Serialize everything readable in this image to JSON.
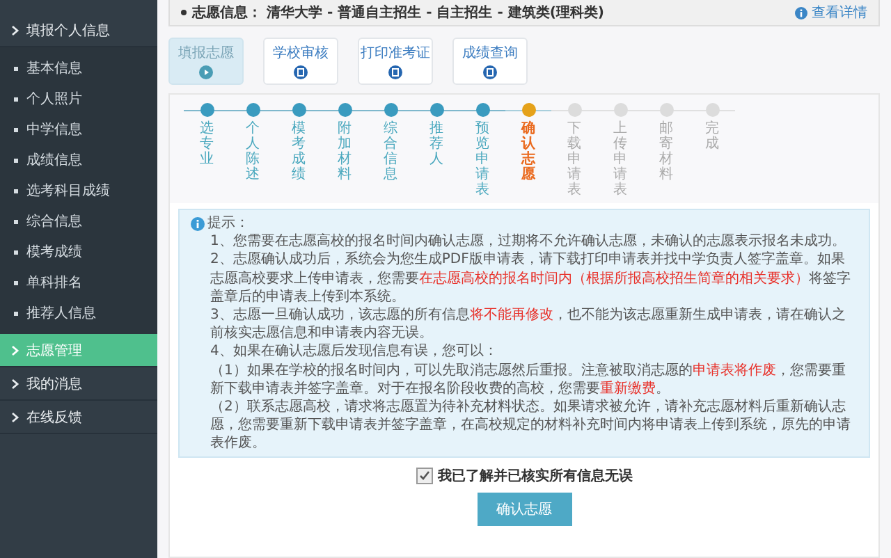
{
  "sidebar": {
    "items": [
      {
        "label": "填报个人信息",
        "selected": false,
        "children": [
          {
            "label": "基本信息"
          },
          {
            "label": "个人照片"
          },
          {
            "label": "中学信息"
          },
          {
            "label": "成绩信息"
          },
          {
            "label": "选考科目成绩"
          },
          {
            "label": "综合信息"
          },
          {
            "label": "模考成绩"
          },
          {
            "label": "单科排名"
          },
          {
            "label": "推荐人信息"
          }
        ]
      },
      {
        "label": "志愿管理",
        "selected": true
      },
      {
        "label": "我的消息",
        "selected": false
      },
      {
        "label": "在线反馈",
        "selected": false
      }
    ]
  },
  "info_bar": {
    "text": "志愿信息： 清华大学 - 普通自主招生 - 自主招生 - 建筑类(理科类)",
    "link": "查看详情"
  },
  "tabs": [
    {
      "label": "填报志愿",
      "selected": true
    },
    {
      "label": "学校审核",
      "selected": false
    },
    {
      "label": "打印准考证",
      "selected": false
    },
    {
      "label": "成绩查询",
      "selected": false
    }
  ],
  "steps": [
    {
      "label": "选专业",
      "done": true,
      "selected": false
    },
    {
      "label": "个人陈述",
      "done": true,
      "selected": false
    },
    {
      "label": "模考成绩",
      "done": true,
      "selected": false
    },
    {
      "label": "附加材料",
      "done": true,
      "selected": false
    },
    {
      "label": "综合信息",
      "done": true,
      "selected": false
    },
    {
      "label": "推荐人",
      "done": true,
      "selected": false
    },
    {
      "label": "预览申请表",
      "done": true,
      "selected": false
    },
    {
      "label": "确认志愿",
      "done": false,
      "selected": true
    },
    {
      "label": "下载申请表",
      "done": false,
      "selected": false
    },
    {
      "label": "上传申请表",
      "done": false,
      "selected": false
    },
    {
      "label": "邮寄材料",
      "done": false,
      "selected": false
    },
    {
      "label": "完成",
      "done": false,
      "selected": false
    }
  ],
  "notice": {
    "title": "提示：",
    "paragraphs": [
      {
        "parts": [
          {
            "text": "1、您需要在志愿高校的报名时间内确认志愿，过期将不允许确认志愿，未确认的志愿表示报名未成功。",
            "highlight": false
          }
        ]
      },
      {
        "parts": [
          {
            "text": "2、志愿确认成功后，系统会为您生成PDF版申请表，请下载打印申请表并找中学负责人签字盖章。如果志愿高校要求上传申请表，您需要",
            "highlight": false
          },
          {
            "text": "在志愿高校的报名时间内（根据所报高校招生简章的相关要求）",
            "highlight": true
          },
          {
            "text": "将签字盖章后的申请表上传到本系统。",
            "highlight": false
          }
        ]
      },
      {
        "parts": [
          {
            "text": "3、志愿一旦确认成功，该志愿的所有信息",
            "highlight": false
          },
          {
            "text": "将不能再修改",
            "highlight": true
          },
          {
            "text": "，也不能为该志愿重新生成申请表，请在确认之前核实志愿信息和申请表内容无误。",
            "highlight": false
          }
        ]
      },
      {
        "parts": [
          {
            "text": "4、如果在确认志愿后发现信息有误，您可以：",
            "highlight": false
          }
        ]
      },
      {
        "parts": [
          {
            "text": "（1）如果在学校的报名时间内，可以先取消志愿然后重报。注意被取消志愿的",
            "highlight": false
          },
          {
            "text": "申请表将作废",
            "highlight": true
          },
          {
            "text": "，您需要重新下载申请表并签字盖章。对于在报名阶段收费的高校，您需要",
            "highlight": false
          },
          {
            "text": "重新缴费",
            "highlight": true
          },
          {
            "text": "。",
            "highlight": false
          }
        ]
      },
      {
        "parts": [
          {
            "text": "（2）联系志愿高校，请求将志愿置为待补充材料状态。如果请求被允许，请补充志愿材料后重新确认志愿，您需要重新下载申请表并签字盖章，在高校规定的材料补充时间内将申请表上传到系统，原先的申请表作废。",
            "highlight": false
          }
        ]
      }
    ]
  },
  "agreement": {
    "label": "我已了解并已核实所有信息无误",
    "checked": true
  },
  "confirm_button": "确认志愿"
}
